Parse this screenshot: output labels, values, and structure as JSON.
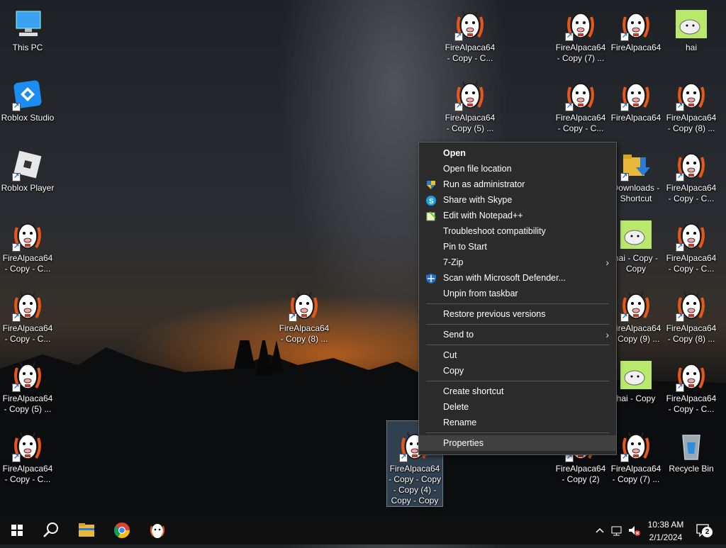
{
  "desktop": {
    "icons": [
      {
        "label": "This PC",
        "kind": "pc"
      },
      {
        "label": "Roblox Studio",
        "kind": "roblox-studio"
      },
      {
        "label": "Roblox Player",
        "kind": "roblox-player"
      },
      {
        "label": "FireAlpaca64 - Copy - C...",
        "kind": "alpaca"
      },
      {
        "label": "FireAlpaca64 - Copy - C...",
        "kind": "alpaca"
      },
      {
        "label": "FireAlpaca64 - Copy (5) ...",
        "kind": "alpaca"
      },
      {
        "label": "FireAlpaca64 - Copy - C...",
        "kind": "alpaca"
      },
      {
        "label": "FireAlpaca64 - Copy (8) ...",
        "kind": "alpaca"
      },
      {
        "label": "FireAlpaca64 - Copy - C...",
        "kind": "alpaca"
      },
      {
        "label": "FireAlpaca64 - Copy (5) ...",
        "kind": "alpaca"
      },
      {
        "label": "FireAlpaca64 - Copy - Copy - Copy (4) - Copy - Copy",
        "kind": "alpaca"
      },
      {
        "label": "FireAlpaca64 - Copy (7) ...",
        "kind": "alpaca"
      },
      {
        "label": "FireAlpaca64 - Copy - C...",
        "kind": "alpaca"
      },
      {
        "label": "FireAlpaca64 - Copy (2)",
        "kind": "alpaca"
      },
      {
        "label": "FireAlpaca64",
        "kind": "alpaca"
      },
      {
        "label": "FireAlpaca64",
        "kind": "alpaca"
      },
      {
        "label": "Downloads - Shortcut",
        "kind": "downloads"
      },
      {
        "label": "hai - Copy - Copy",
        "kind": "hai"
      },
      {
        "label": "FireAlpaca64 - Copy (9) ...",
        "kind": "alpaca"
      },
      {
        "label": "hai - Copy",
        "kind": "hai"
      },
      {
        "label": "FireAlpaca64 - Copy (7) ...",
        "kind": "alpaca"
      },
      {
        "label": "hai",
        "kind": "hai"
      },
      {
        "label": "FireAlpaca64 - Copy (8) ...",
        "kind": "alpaca"
      },
      {
        "label": "FireAlpaca64 - Copy - C...",
        "kind": "alpaca"
      },
      {
        "label": "FireAlpaca64 - Copy - C...",
        "kind": "alpaca"
      },
      {
        "label": "FireAlpaca64 - Copy (8) ...",
        "kind": "alpaca"
      },
      {
        "label": "FireAlpaca64 - Copy - C...",
        "kind": "alpaca"
      },
      {
        "label": "Recycle Bin",
        "kind": "recycle"
      }
    ]
  },
  "context_menu": {
    "items": [
      {
        "label": "Open",
        "icon": "",
        "bold": true
      },
      {
        "label": "Open file location",
        "icon": ""
      },
      {
        "label": "Run as administrator",
        "icon": "shield-icon"
      },
      {
        "label": "Share with Skype",
        "icon": "skype-icon"
      },
      {
        "label": "Edit with Notepad++",
        "icon": "notepad-plus-plus-icon"
      },
      {
        "label": "Troubleshoot compatibility",
        "icon": ""
      },
      {
        "label": "Pin to Start",
        "icon": ""
      },
      {
        "label": "7-Zip",
        "icon": "",
        "submenu": true
      },
      {
        "label": "Scan with Microsoft Defender...",
        "icon": "defender-icon"
      },
      {
        "label": "Unpin from taskbar",
        "icon": ""
      },
      {
        "separator": true
      },
      {
        "label": "Restore previous versions",
        "icon": ""
      },
      {
        "separator": true
      },
      {
        "label": "Send to",
        "icon": "",
        "submenu": true
      },
      {
        "separator": true
      },
      {
        "label": "Cut",
        "icon": ""
      },
      {
        "label": "Copy",
        "icon": ""
      },
      {
        "separator": true
      },
      {
        "label": "Create shortcut",
        "icon": ""
      },
      {
        "label": "Delete",
        "icon": ""
      },
      {
        "label": "Rename",
        "icon": ""
      },
      {
        "separator": true
      },
      {
        "label": "Properties",
        "icon": "",
        "hover": true
      }
    ]
  },
  "taskbar": {
    "apps": [
      "start-icon",
      "search-icon",
      "file-explorer-icon",
      "chrome-icon",
      "firealpaca-icon"
    ],
    "clock": {
      "time": "10:38 AM",
      "date": "2/1/2024"
    },
    "notification_count": "2"
  }
}
